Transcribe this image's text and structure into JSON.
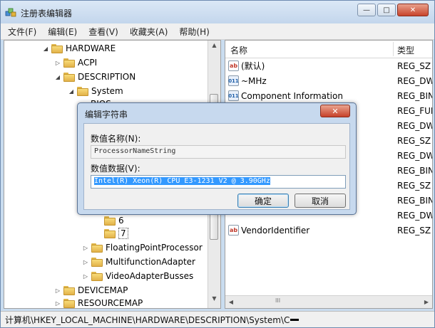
{
  "window": {
    "title": "注册表编辑器",
    "buttons": {
      "minimize": "—",
      "maximize": "□",
      "close": "✕"
    }
  },
  "menu": [
    "文件(F)",
    "编辑(E)",
    "查看(V)",
    "收藏夹(A)",
    "帮助(H)"
  ],
  "tree": [
    {
      "label": "HARDWARE",
      "depth": 0,
      "expander": "◢"
    },
    {
      "label": "ACPI",
      "depth": 1,
      "expander": "▷"
    },
    {
      "label": "DESCRIPTION",
      "depth": 1,
      "expander": "◢"
    },
    {
      "label": "System",
      "depth": 2,
      "expander": "◢"
    },
    {
      "label": "BIOS",
      "depth": 3,
      "expander": ""
    },
    {
      "label": "6",
      "depth": 4,
      "expander": ""
    },
    {
      "label": "7",
      "depth": 4,
      "expander": "",
      "selected": true
    },
    {
      "label": "FloatingPointProcessor",
      "depth": 3,
      "expander": "▷"
    },
    {
      "label": "MultifunctionAdapter",
      "depth": 3,
      "expander": "▷"
    },
    {
      "label": "VideoAdapterBusses",
      "depth": 3,
      "expander": "▷"
    },
    {
      "label": "DEVICEMAP",
      "depth": 1,
      "expander": "▷"
    },
    {
      "label": "RESOURCEMAP",
      "depth": 1,
      "expander": "▷"
    }
  ],
  "list": {
    "headers": {
      "name": "名称",
      "type": "类型"
    },
    "rows": [
      {
        "icon": "ab",
        "name": "(默认)",
        "type": "REG_SZ"
      },
      {
        "icon": "bin",
        "name": "~MHz",
        "type": "REG_DW"
      },
      {
        "icon": "bin",
        "name": "Component Information",
        "type": "REG_BIN"
      },
      {
        "icon": "bin",
        "name": "",
        "type": "REG_FUL"
      },
      {
        "icon": "bin",
        "name": "",
        "type": "REG_DW"
      },
      {
        "icon": "ab",
        "name": "",
        "type": "REG_SZ"
      },
      {
        "icon": "bin",
        "name": "",
        "type": "REG_DW"
      },
      {
        "icon": "bin",
        "name": "",
        "type": "REG_BIN"
      },
      {
        "icon": "ab",
        "name": "",
        "type": "REG_SZ"
      },
      {
        "icon": "bin",
        "name": "",
        "type": "REG_BIN"
      },
      {
        "icon": "bin",
        "name": "",
        "type": "REG_DW"
      },
      {
        "icon": "ab",
        "name": "VendorIdentifier",
        "type": "REG_SZ"
      }
    ],
    "hscroll_grip": "III"
  },
  "status": {
    "path": "计算机\\HKEY_LOCAL_MACHINE\\HARDWARE\\DESCRIPTION\\System\\C"
  },
  "dialog": {
    "title": "编辑字符串",
    "close": "✕",
    "name_label": "数值名称(N):",
    "name_value": "ProcessorNameString",
    "data_label": "数值数据(V):",
    "data_value": "Intel(R) Xeon(R) CPU E3-1231 V2 @ 3.90GHz",
    "ok": "确定",
    "cancel": "取消"
  }
}
